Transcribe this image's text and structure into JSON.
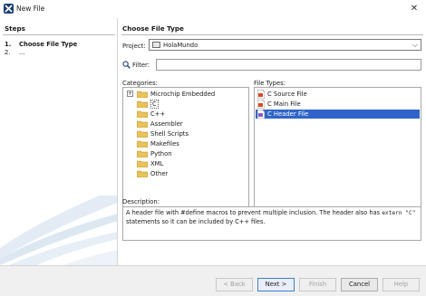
{
  "window": {
    "title": "New File",
    "app_icon": "netbeans-logo-icon",
    "close_icon": "close-icon",
    "close_glyph": "✕"
  },
  "steps": {
    "header": "Steps",
    "items": [
      {
        "num": "1.",
        "label": "Choose File Type",
        "current": true
      },
      {
        "num": "2.",
        "label": "...",
        "current": false
      }
    ]
  },
  "main": {
    "header": "Choose File Type",
    "project_label": "Project:",
    "project_value": "HolaMundo",
    "project_icon": "project-icon",
    "combo_arrow": "⌵",
    "filter_label": "Filter:",
    "filter_value": "",
    "filter_icon": "search-icon",
    "categories_label": "Categories:",
    "categories": [
      {
        "label": "Microchip Embedded",
        "expander": "+",
        "selected": false
      },
      {
        "label": "C",
        "expander": "",
        "selected": true
      },
      {
        "label": "C++",
        "expander": "",
        "selected": false
      },
      {
        "label": "Assembler",
        "expander": "",
        "selected": false
      },
      {
        "label": "Shell Scripts",
        "expander": "",
        "selected": false
      },
      {
        "label": "Makefiles",
        "expander": "",
        "selected": false
      },
      {
        "label": "Python",
        "expander": "",
        "selected": false
      },
      {
        "label": "XML",
        "expander": "",
        "selected": false
      },
      {
        "label": "Other",
        "expander": "",
        "selected": false
      }
    ],
    "filetypes_label": "File Types:",
    "filetypes": [
      {
        "label": "C Source File",
        "selected": false
      },
      {
        "label": "C Main File",
        "selected": false
      },
      {
        "label": "C Header File",
        "selected": true
      }
    ],
    "description_label": "Description:",
    "description": {
      "text1": "A header file with #define macros to prevent multiple inclusion. The header also has ",
      "code1": "extern \"C\"",
      "text2": "statements so it can be included by C++ files."
    }
  },
  "footer": {
    "back": "< Back",
    "next": "Next >",
    "finish": "Finish",
    "cancel": "Cancel",
    "help": "Help"
  },
  "colors": {
    "selection": "#2f65c9",
    "folder": "#e9c35a",
    "deco": "#dfe9f3"
  }
}
